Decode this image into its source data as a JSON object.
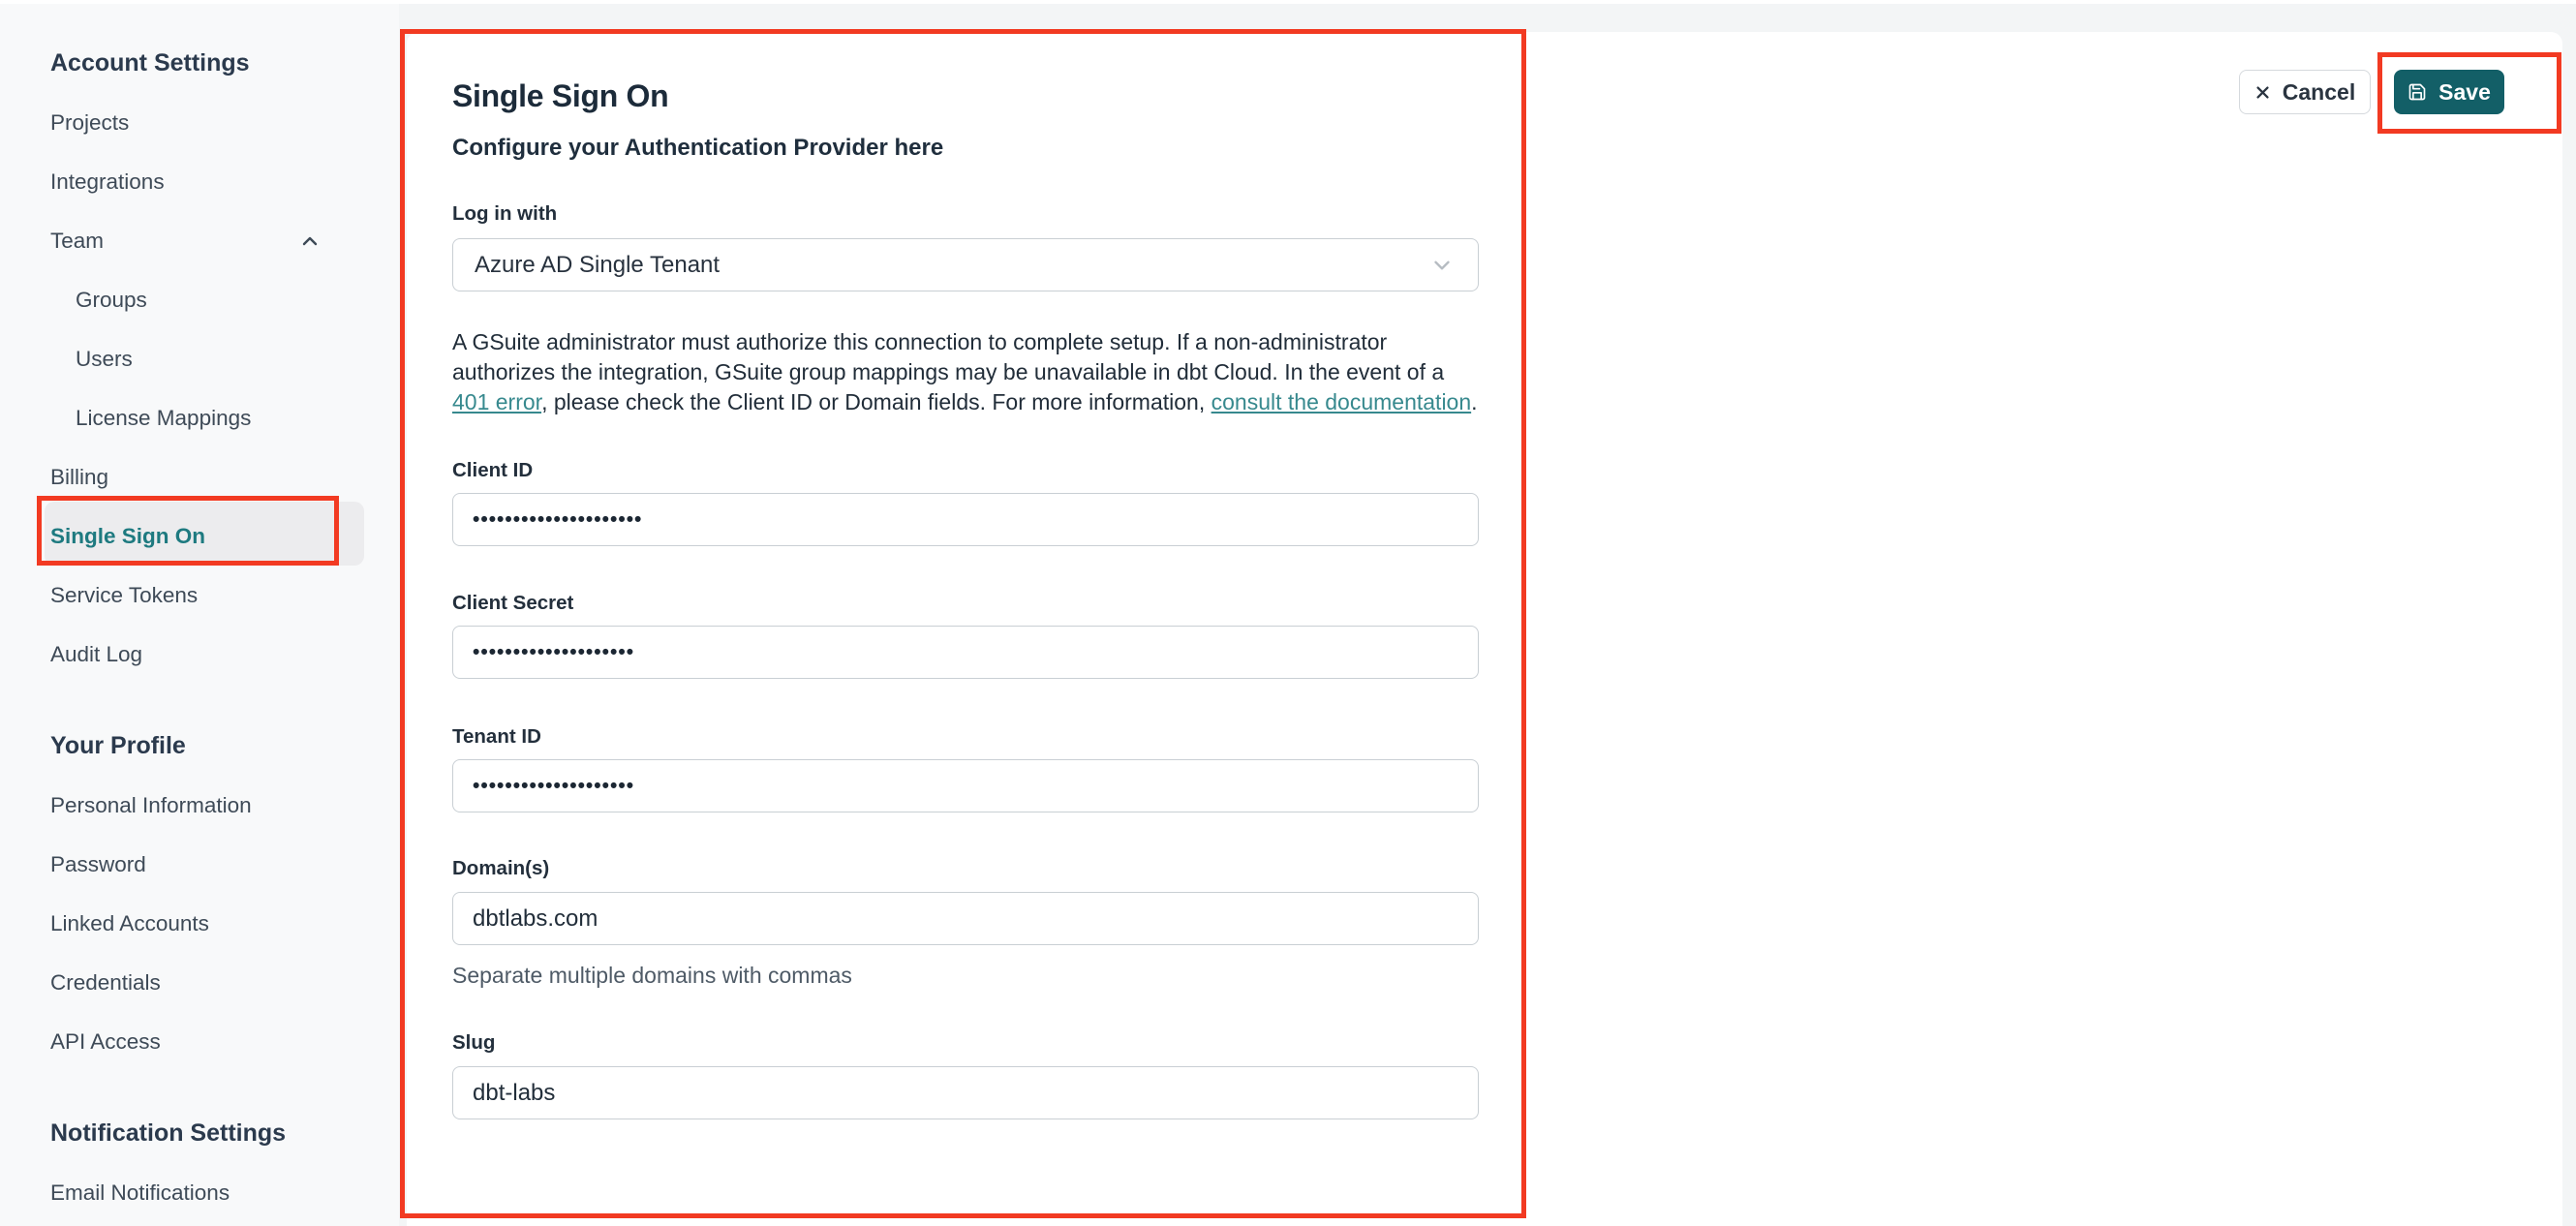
{
  "colors": {
    "annotation_red": "#f23a22",
    "save_button_teal": "#135f67",
    "selected_nav_teal": "#1e7a80",
    "link_teal": "#37898e"
  },
  "sidebar": {
    "sections": [
      {
        "heading": "Account Settings",
        "items": [
          {
            "label": "Projects"
          },
          {
            "label": "Integrations"
          },
          {
            "label": "Team"
          },
          {
            "label": "Groups"
          },
          {
            "label": "Users"
          },
          {
            "label": "License Mappings"
          },
          {
            "label": "Billing"
          },
          {
            "label": "Single Sign On"
          },
          {
            "label": "Service Tokens"
          },
          {
            "label": "Audit Log"
          }
        ]
      },
      {
        "heading": "Your Profile",
        "items": [
          {
            "label": "Personal Information"
          },
          {
            "label": "Password"
          },
          {
            "label": "Linked Accounts"
          },
          {
            "label": "Credentials"
          },
          {
            "label": "API Access"
          }
        ]
      },
      {
        "heading": "Notification Settings",
        "items": [
          {
            "label": "Email Notifications"
          }
        ]
      }
    ]
  },
  "toolbar": {
    "cancel_label": "Cancel",
    "save_label": "Save"
  },
  "sso": {
    "title": "Single Sign On",
    "subtitle": "Configure your Authentication Provider here",
    "login_with": {
      "label": "Log in with",
      "value": "Azure AD Single Tenant"
    },
    "notice": {
      "part1": "A GSuite administrator must authorize this connection to complete setup. If a non-administrator authorizes the integration, GSuite group mappings may be unavailable in dbt Cloud. In the event of a ",
      "link1": "401 error",
      "part2": ", please check the Client ID or Domain fields. For more information, ",
      "link2": "consult the documentation",
      "part3": "."
    },
    "fields": {
      "client_id": {
        "label": "Client ID",
        "value": "•••••••••••••••••••••"
      },
      "client_secret": {
        "label": "Client Secret",
        "value": "••••••••••••••••••••"
      },
      "tenant_id": {
        "label": "Tenant ID",
        "value": "••••••••••••••••••••"
      },
      "domains": {
        "label": "Domain(s)",
        "value": "dbtlabs.com",
        "helper": "Separate multiple domains with commas"
      },
      "slug": {
        "label": "Slug",
        "value": "dbt-labs"
      }
    }
  }
}
